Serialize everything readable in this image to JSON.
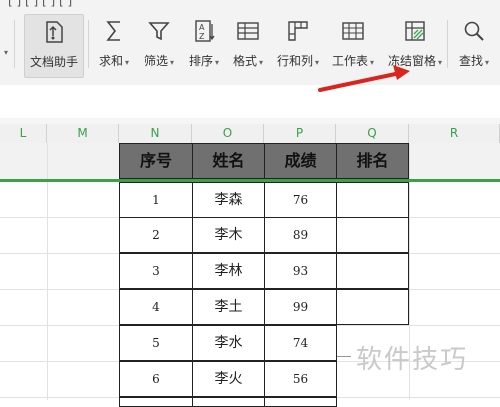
{
  "toolbar": {
    "top_fragment": "[ ] [ ] [ ] [ ]",
    "doc_helper_label": "文档助手",
    "sum_label": "求和",
    "filter_label": "筛选",
    "sort_label": "排序",
    "format_label": "格式",
    "rowcol_label": "行和列",
    "sheet_label": "工作表",
    "freeze_label": "冻结窗格",
    "find_label": "查找"
  },
  "columns": [
    "L",
    "M",
    "N",
    "O",
    "P",
    "Q",
    "R"
  ],
  "table": {
    "headers": [
      "序号",
      "姓名",
      "成绩",
      "排名"
    ],
    "rows": [
      {
        "idx": "1",
        "name": "李森",
        "score": "76"
      },
      {
        "idx": "2",
        "name": "李木",
        "score": "89"
      },
      {
        "idx": "3",
        "name": "李林",
        "score": "93"
      },
      {
        "idx": "4",
        "name": "李土",
        "score": "99"
      },
      {
        "idx": "5",
        "name": "李水",
        "score": "74"
      },
      {
        "idx": "6",
        "name": "李火",
        "score": "56"
      }
    ]
  },
  "watermark": "软件技巧",
  "colors": {
    "accent_green": "#3aa04a",
    "arrow_red": "#d9251d",
    "header_fill": "#707070"
  }
}
